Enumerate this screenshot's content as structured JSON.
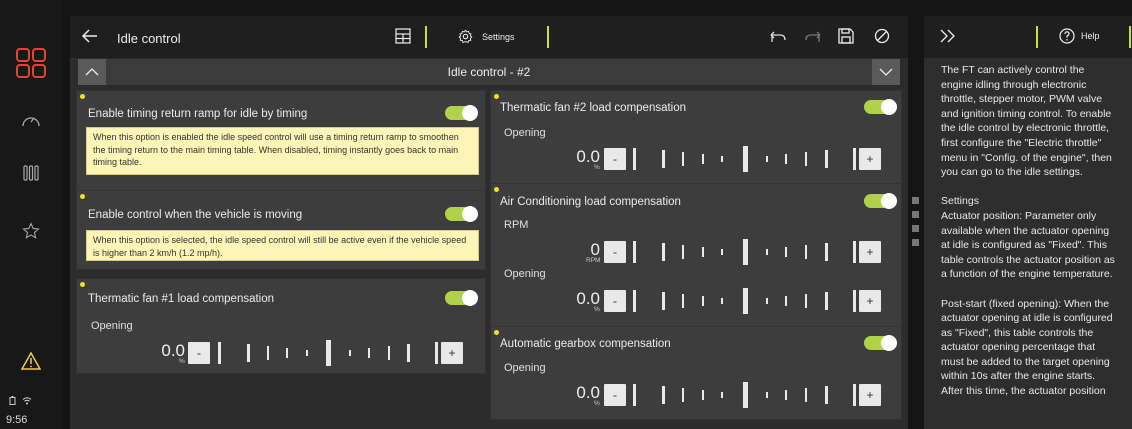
{
  "status": {
    "time": "9:56"
  },
  "toolbar": {
    "title": "Idle control",
    "settings_label": "Settings"
  },
  "titlebar": {
    "label": "Idle control - #2"
  },
  "left_panels": {
    "timing": {
      "title": "Enable timing return ramp for idle by timing",
      "note": "When this option is enabled the idle speed control will use a timing return ramp to smoothen the timing return to the main timing table. When disabled, timing instantly goes back to main timing table."
    },
    "moving": {
      "title": "Enable control when the vehicle is moving",
      "note": "When this option is selected, the idle speed control will still be active even if the vehicle speed is higher than 2 km/h (1.2 mp/h)."
    },
    "fan1": {
      "title": "Thermatic fan #1 load compensation",
      "label": "Opening",
      "value": "0.0",
      "unit": "%"
    }
  },
  "right_panels": {
    "fan2": {
      "title": "Thermatic fan #2 load compensation",
      "label": "Opening",
      "value": "0.0",
      "unit": "%"
    },
    "ac": {
      "title": "Air Conditioning load compensation",
      "rpm_label": "RPM",
      "rpm_value": "0",
      "rpm_unit": "RPM",
      "open_label": "Opening",
      "open_value": "0.0",
      "open_unit": "%"
    },
    "gearbox": {
      "title": "Automatic gearbox compensation",
      "label": "Opening",
      "value": "0.0",
      "unit": "%"
    }
  },
  "buttons": {
    "minus": "-",
    "plus": "+"
  },
  "help": {
    "label": "Help",
    "text": "The FT can actively control the engine idling through electronic throttle, stepper motor, PWM valve and ignition timing control. To enable the idle control by electronic throttle, first configure the \"Electric throttle\" menu in \"Config. of the engine\", then you can go to the idle settings.\n\nSettings\nActuator position: Parameter only available when the actuator opening at idle is configured as \"Fixed\". This table controls the actuator position as a function of the engine temperature.\n\nPost-start (fixed opening): When the actuator opening at idle is configured as \"Fixed\", this table controls the actuator opening percentage that must be added to the target opening within 10s after the engine starts. After this time, the actuator position"
  },
  "colors": {
    "accent": "#c9e03c",
    "brand": "#e8462c",
    "warning": "#f2c94c",
    "note_bg": "#fdf5b8"
  }
}
